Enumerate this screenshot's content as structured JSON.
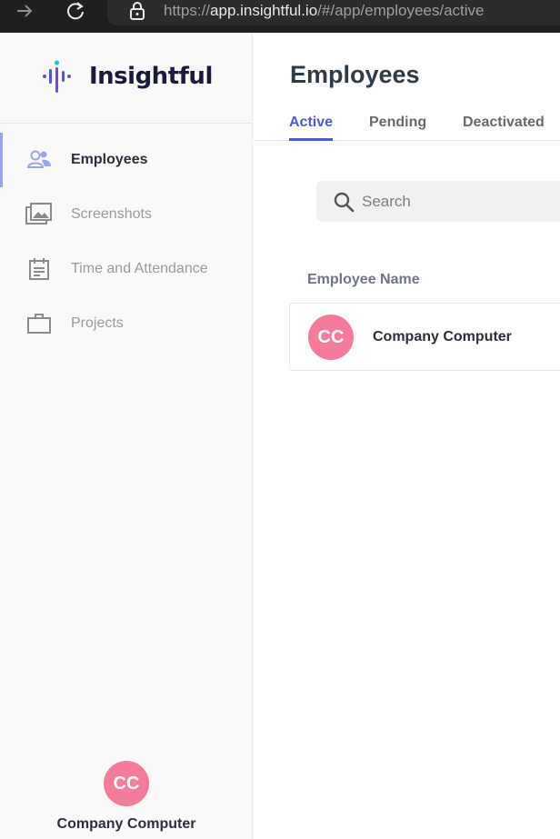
{
  "browser": {
    "url_scheme": "https://",
    "url_host": "app.insightful.io",
    "url_path": "/#/app/employees/active"
  },
  "sidebar": {
    "logo_text": "Insightful",
    "items": [
      {
        "label": "Employees",
        "icon": "people-icon",
        "active": true
      },
      {
        "label": "Screenshots",
        "icon": "images-icon",
        "active": false
      },
      {
        "label": "Time and Attendance",
        "icon": "calendar-icon",
        "active": false
      },
      {
        "label": "Projects",
        "icon": "briefcase-icon",
        "active": false
      }
    ],
    "user": {
      "initials": "CC",
      "name": "Company Computer"
    }
  },
  "main": {
    "title": "Employees",
    "tabs": [
      {
        "label": "Active",
        "active": true
      },
      {
        "label": "Pending",
        "active": false
      },
      {
        "label": "Deactivated",
        "active": false
      }
    ],
    "search": {
      "placeholder": "Search",
      "value": ""
    },
    "table": {
      "column_header": "Employee Name",
      "rows": [
        {
          "initials": "CC",
          "name": "Company Computer"
        }
      ]
    }
  },
  "colors": {
    "accent": "#4c5bd4",
    "active_indicator": "#9ba3eb",
    "avatar": "#f47c9a"
  }
}
